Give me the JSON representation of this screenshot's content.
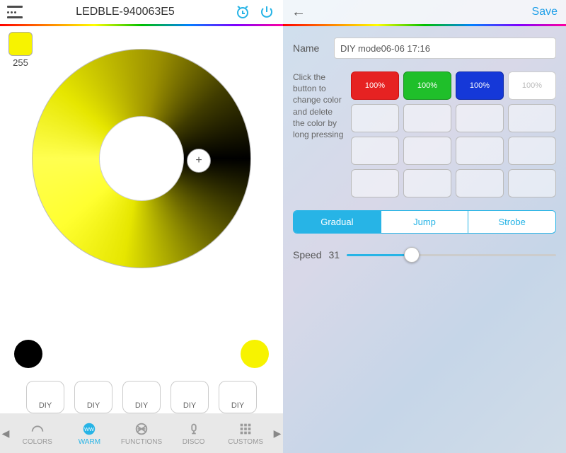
{
  "left": {
    "device_title": "LEDBLE-940063E5",
    "swatch_color": "#f7f300",
    "swatch_value": "255",
    "cursor_glyph": "+",
    "endpoint_left_color": "#000000",
    "endpoint_right_color": "#f7f300",
    "diy_buttons": [
      "DIY",
      "DIY",
      "DIY",
      "DIY",
      "DIY"
    ],
    "tabs": {
      "items": [
        {
          "label": "COLORS"
        },
        {
          "label": "WARM"
        },
        {
          "label": "FUNCTIONS"
        },
        {
          "label": "DISCO"
        },
        {
          "label": "CUSTOMS"
        }
      ],
      "active_index": 1
    }
  },
  "right": {
    "save_label": "Save",
    "name_label": "Name",
    "name_value": "DIY mode06-06 17:16",
    "help_text": "Click the button to change color and delete the color by long pressing",
    "cells": [
      {
        "pct": "100%",
        "cls": "filled-red"
      },
      {
        "pct": "100%",
        "cls": "filled-green"
      },
      {
        "pct": "100%",
        "cls": "filled-blue"
      },
      {
        "pct": "100%",
        "cls": "filled-white"
      },
      {
        "pct": "",
        "cls": ""
      },
      {
        "pct": "",
        "cls": ""
      },
      {
        "pct": "",
        "cls": ""
      },
      {
        "pct": "",
        "cls": ""
      },
      {
        "pct": "",
        "cls": ""
      },
      {
        "pct": "",
        "cls": ""
      },
      {
        "pct": "",
        "cls": ""
      },
      {
        "pct": "",
        "cls": ""
      },
      {
        "pct": "",
        "cls": ""
      },
      {
        "pct": "",
        "cls": ""
      },
      {
        "pct": "",
        "cls": ""
      },
      {
        "pct": "",
        "cls": ""
      }
    ],
    "seg": {
      "items": [
        "Gradual",
        "Jump",
        "Strobe"
      ],
      "active_index": 0
    },
    "speed_label": "Speed",
    "speed_value": "31",
    "speed_pct": 31
  }
}
